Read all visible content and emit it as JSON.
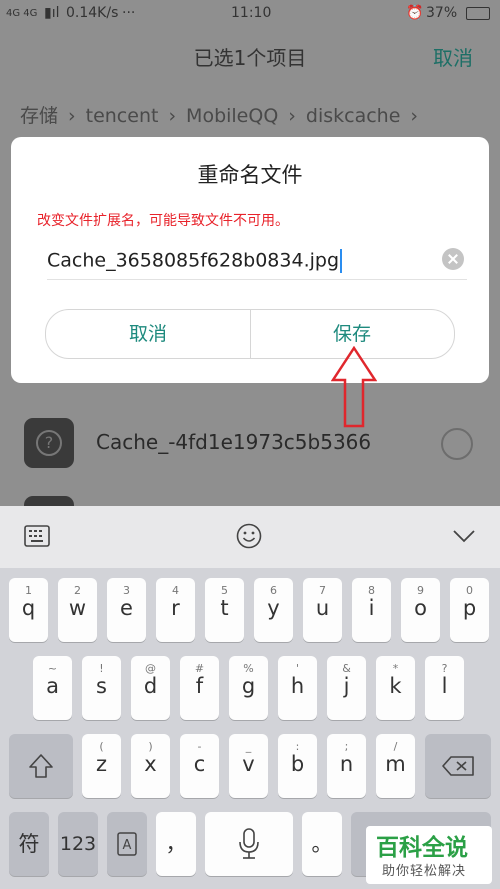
{
  "status_bar": {
    "network": "4G 4G",
    "speed": "0.14K/s",
    "dots": "···",
    "time": "11:10",
    "battery": "37%"
  },
  "header": {
    "title": "已选1个项目",
    "cancel": "取消"
  },
  "breadcrumb": [
    "存储",
    "tencent",
    "MobileQQ",
    "diskcache"
  ],
  "files": [
    {
      "name": "Cache_-4fd1e1973c5b5366"
    }
  ],
  "dialog": {
    "title": "重命名文件",
    "warning": "改变文件扩展名，可能导致文件不可用。",
    "filename": "Cache_3658085f628b0834.jpg",
    "cancel": "取消",
    "save": "保存"
  },
  "keyboard": {
    "row1": [
      {
        "sub": "1",
        "main": "q"
      },
      {
        "sub": "2",
        "main": "w"
      },
      {
        "sub": "3",
        "main": "e"
      },
      {
        "sub": "4",
        "main": "r"
      },
      {
        "sub": "5",
        "main": "t"
      },
      {
        "sub": "6",
        "main": "y"
      },
      {
        "sub": "7",
        "main": "u"
      },
      {
        "sub": "8",
        "main": "i"
      },
      {
        "sub": "9",
        "main": "o"
      },
      {
        "sub": "0",
        "main": "p"
      }
    ],
    "row2": [
      {
        "sub": "~",
        "main": "a"
      },
      {
        "sub": "!",
        "main": "s"
      },
      {
        "sub": "@",
        "main": "d"
      },
      {
        "sub": "#",
        "main": "f"
      },
      {
        "sub": "%",
        "main": "g"
      },
      {
        "sub": "'",
        "main": "h"
      },
      {
        "sub": "&",
        "main": "j"
      },
      {
        "sub": "*",
        "main": "k"
      },
      {
        "sub": "?",
        "main": "l"
      }
    ],
    "row3": [
      {
        "sub": "(",
        "main": "z"
      },
      {
        "sub": ")",
        "main": "x"
      },
      {
        "sub": "-",
        "main": "c"
      },
      {
        "sub": "_",
        "main": "v"
      },
      {
        "sub": ":",
        "main": "b"
      },
      {
        "sub": ";",
        "main": "n"
      },
      {
        "sub": "/",
        "main": "m"
      }
    ],
    "symbol_key": "符",
    "number_key": "123",
    "comma": "，",
    "period": "。"
  },
  "watermark": {
    "title": "百科全说",
    "subtitle": "助你轻松解决"
  },
  "colors": {
    "accent": "#1e8a7e",
    "warning": "#e8232b",
    "arrow": "#e0272d"
  }
}
